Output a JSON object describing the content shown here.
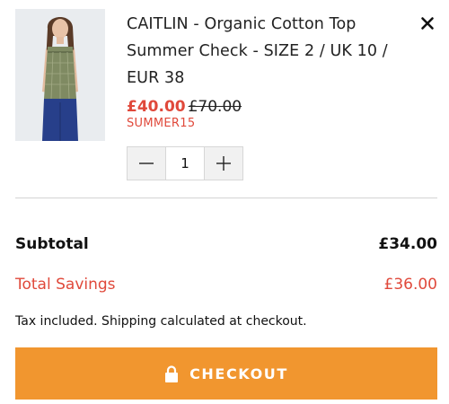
{
  "cart_item": {
    "title": "CAITLIN - Organic Cotton Top Summer Check - SIZE 2 / UK 10 / EUR 38",
    "sale_price": "£40.00",
    "original_price": "£70.00",
    "discount_code": "SUMMER15",
    "quantity": "1",
    "image_icon": "product-photo",
    "remove_icon": "close-icon",
    "decrease_icon": "minus-icon",
    "increase_icon": "plus-icon"
  },
  "summary": {
    "subtotal_label": "Subtotal",
    "subtotal_value": "£34.00",
    "savings_label": "Total Savings",
    "savings_value": "£36.00",
    "tax_note": "Tax included. Shipping calculated at checkout."
  },
  "checkout": {
    "label": "CHECKOUT",
    "icon": "lock-icon"
  },
  "colors": {
    "accent": "#f1962f",
    "sale": "#e0493b",
    "text": "#111111",
    "divider": "#d3d3d3"
  }
}
